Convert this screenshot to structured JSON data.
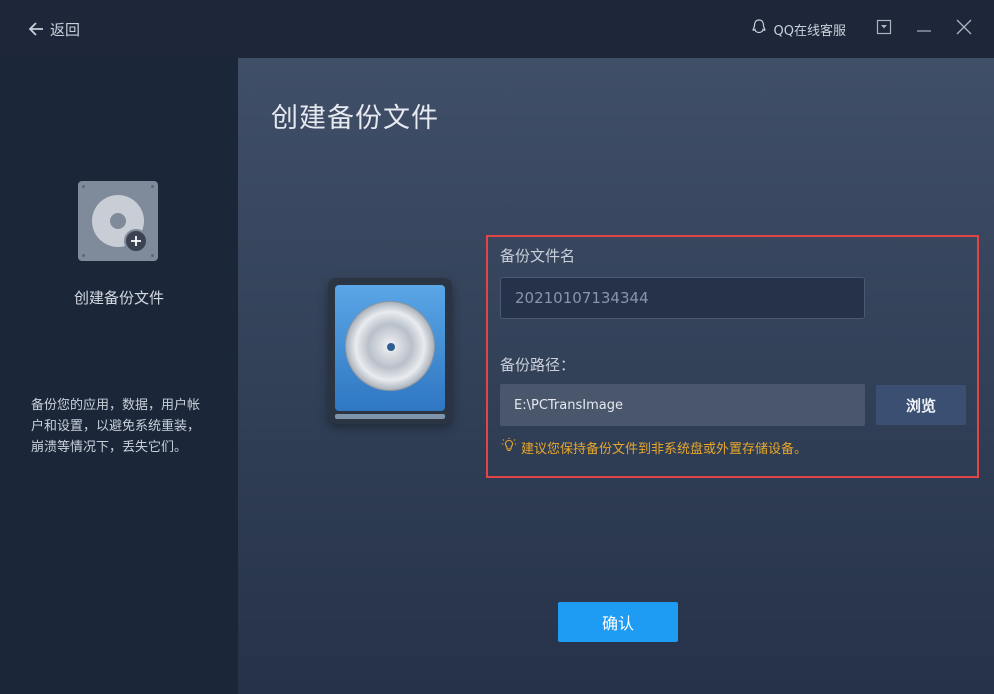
{
  "titlebar": {
    "back_label": "返回",
    "qq_service_label": "QQ在线客服"
  },
  "sidebar": {
    "item_title": "创建备份文件",
    "description": "备份您的应用，数据，用户帐户和设置，以避免系统重装，崩溃等情况下，丢失它们。"
  },
  "main": {
    "page_title": "创建备份文件",
    "filename_label": "备份文件名",
    "filename_value": "20210107134344",
    "path_label": "备份路径：",
    "path_value": "E:\\PCTransImage",
    "browse_label": "浏览",
    "tip": "建议您保持备份文件到非系统盘或外置存储设备。",
    "confirm_label": "确认"
  },
  "icons": [
    "back-arrow-icon",
    "qq-icon",
    "dropdown-icon",
    "minimize-icon",
    "close-icon",
    "create-backup-icon",
    "plus-icon",
    "backup-disk-image",
    "lightbulb-icon"
  ],
  "colors": {
    "accent": "#1e9bf2",
    "highlight_border": "#e24545",
    "tip": "#e8a72a"
  }
}
